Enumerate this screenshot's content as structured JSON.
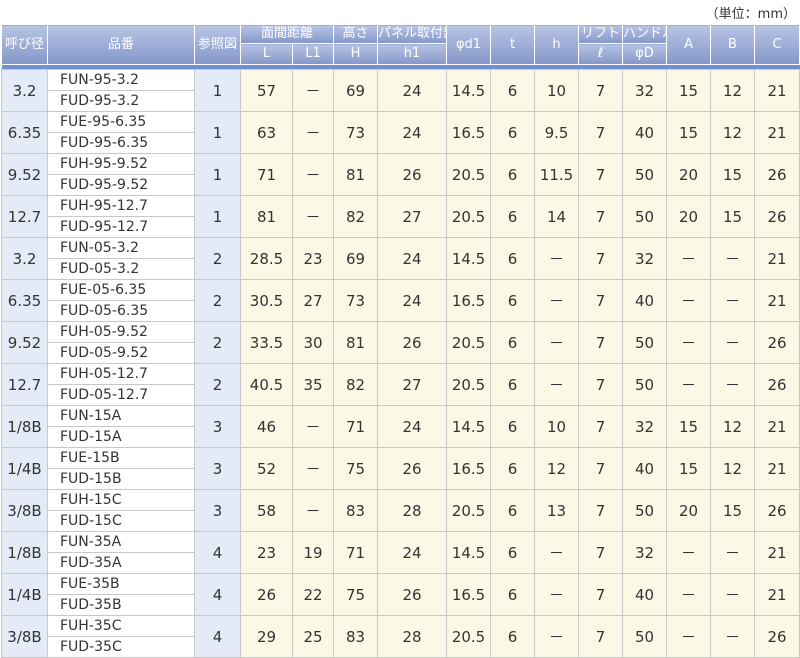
{
  "unit_label": "（単位：mm）",
  "headers": {
    "size": "呼び径",
    "part": "品番",
    "ref": "参照図",
    "face_distance": "面間距離",
    "L": "L",
    "L1": "L1",
    "height": "高さ",
    "H": "H",
    "panel": "パネル取付部",
    "h1": "h1",
    "d1": "φd1",
    "t": "t",
    "h": "h",
    "lift": "リフト",
    "lift_sym": "ℓ",
    "handle": "ハンドル",
    "D": "φD",
    "A": "A",
    "B": "B",
    "C": "C"
  },
  "rows": [
    {
      "size": "3.2",
      "parts": [
        "FUN-95-3.2",
        "FUD-95-3.2"
      ],
      "ref": "1",
      "L": "57",
      "L1": "－",
      "H": "69",
      "h1": "24",
      "d1": "14.5",
      "t": "6",
      "h": "10",
      "lift": "7",
      "D": "32",
      "A": "15",
      "B": "12",
      "C": "21"
    },
    {
      "size": "6.35",
      "parts": [
        "FUE-95-6.35",
        "FUD-95-6.35"
      ],
      "ref": "1",
      "L": "63",
      "L1": "－",
      "H": "73",
      "h1": "24",
      "d1": "16.5",
      "t": "6",
      "h": "9.5",
      "lift": "7",
      "D": "40",
      "A": "15",
      "B": "12",
      "C": "21"
    },
    {
      "size": "9.52",
      "parts": [
        "FUH-95-9.52",
        "FUD-95-9.52"
      ],
      "ref": "1",
      "L": "71",
      "L1": "－",
      "H": "81",
      "h1": "26",
      "d1": "20.5",
      "t": "6",
      "h": "11.5",
      "lift": "7",
      "D": "50",
      "A": "20",
      "B": "15",
      "C": "26"
    },
    {
      "size": "12.7",
      "parts": [
        "FUH-95-12.7",
        "FUD-95-12.7"
      ],
      "ref": "1",
      "L": "81",
      "L1": "－",
      "H": "82",
      "h1": "27",
      "d1": "20.5",
      "t": "6",
      "h": "14",
      "lift": "7",
      "D": "50",
      "A": "20",
      "B": "15",
      "C": "26"
    },
    {
      "size": "3.2",
      "parts": [
        "FUN-05-3.2",
        "FUD-05-3.2"
      ],
      "ref": "2",
      "L": "28.5",
      "L1": "23",
      "H": "69",
      "h1": "24",
      "d1": "14.5",
      "t": "6",
      "h": "－",
      "lift": "7",
      "D": "32",
      "A": "－",
      "B": "－",
      "C": "21"
    },
    {
      "size": "6.35",
      "parts": [
        "FUE-05-6.35",
        "FUD-05-6.35"
      ],
      "ref": "2",
      "L": "30.5",
      "L1": "27",
      "H": "73",
      "h1": "24",
      "d1": "16.5",
      "t": "6",
      "h": "－",
      "lift": "7",
      "D": "40",
      "A": "－",
      "B": "－",
      "C": "21"
    },
    {
      "size": "9.52",
      "parts": [
        "FUH-05-9.52",
        "FUD-05-9.52"
      ],
      "ref": "2",
      "L": "33.5",
      "L1": "30",
      "H": "81",
      "h1": "26",
      "d1": "20.5",
      "t": "6",
      "h": "－",
      "lift": "7",
      "D": "50",
      "A": "－",
      "B": "－",
      "C": "26"
    },
    {
      "size": "12.7",
      "parts": [
        "FUH-05-12.7",
        "FUD-05-12.7"
      ],
      "ref": "2",
      "L": "40.5",
      "L1": "35",
      "H": "82",
      "h1": "27",
      "d1": "20.5",
      "t": "6",
      "h": "－",
      "lift": "7",
      "D": "50",
      "A": "－",
      "B": "－",
      "C": "26"
    },
    {
      "size": "1/8B",
      "parts": [
        "FUN-15A",
        "FUD-15A"
      ],
      "ref": "3",
      "L": "46",
      "L1": "－",
      "H": "71",
      "h1": "24",
      "d1": "14.5",
      "t": "6",
      "h": "10",
      "lift": "7",
      "D": "32",
      "A": "15",
      "B": "12",
      "C": "21"
    },
    {
      "size": "1/4B",
      "parts": [
        "FUE-15B",
        "FUD-15B"
      ],
      "ref": "3",
      "L": "52",
      "L1": "－",
      "H": "75",
      "h1": "26",
      "d1": "16.5",
      "t": "6",
      "h": "12",
      "lift": "7",
      "D": "40",
      "A": "15",
      "B": "12",
      "C": "21"
    },
    {
      "size": "3/8B",
      "parts": [
        "FUH-15C",
        "FUD-15C"
      ],
      "ref": "3",
      "L": "58",
      "L1": "－",
      "H": "83",
      "h1": "28",
      "d1": "20.5",
      "t": "6",
      "h": "13",
      "lift": "7",
      "D": "50",
      "A": "20",
      "B": "15",
      "C": "26"
    },
    {
      "size": "1/8B",
      "parts": [
        "FUN-35A",
        "FUD-35A"
      ],
      "ref": "4",
      "L": "23",
      "L1": "19",
      "H": "71",
      "h1": "24",
      "d1": "14.5",
      "t": "6",
      "h": "－",
      "lift": "7",
      "D": "32",
      "A": "－",
      "B": "－",
      "C": "21"
    },
    {
      "size": "1/4B",
      "parts": [
        "FUE-35B",
        "FUD-35B"
      ],
      "ref": "4",
      "L": "26",
      "L1": "22",
      "H": "75",
      "h1": "26",
      "d1": "16.5",
      "t": "6",
      "h": "－",
      "lift": "7",
      "D": "40",
      "A": "－",
      "B": "－",
      "C": "21"
    },
    {
      "size": "3/8B",
      "parts": [
        "FUH-35C",
        "FUD-35C"
      ],
      "ref": "4",
      "L": "29",
      "L1": "25",
      "H": "83",
      "h1": "28",
      "d1": "20.5",
      "t": "6",
      "h": "－",
      "lift": "7",
      "D": "50",
      "A": "－",
      "B": "－",
      "C": "26"
    }
  ]
}
